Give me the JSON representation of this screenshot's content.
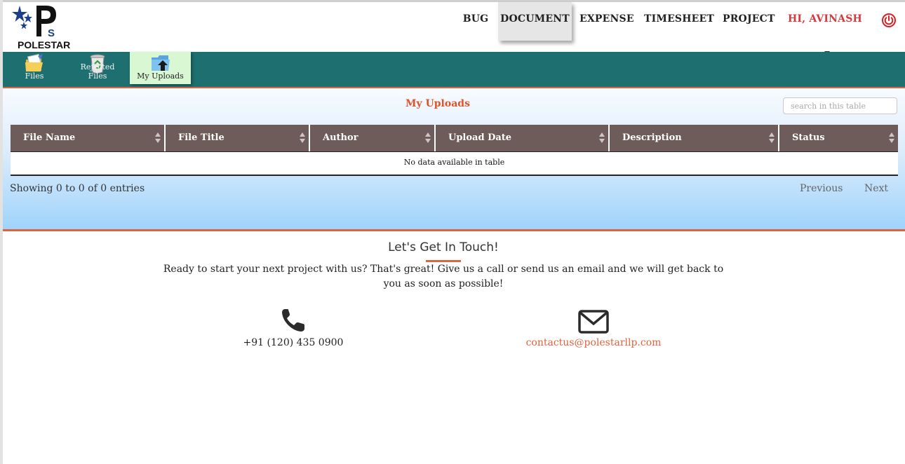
{
  "brand": {
    "logo_text": "POLESTAR",
    "primary_color": "#1e6f70",
    "accent_color": "#e0633d",
    "header_bg": "#6e5c5a"
  },
  "nav": {
    "items": [
      "BUG",
      "DOCUMENT",
      "EXPENSE",
      "TIMESHEET",
      "PROJECT"
    ],
    "active": "DOCUMENT",
    "user": "HI, AVINASH",
    "power_icon": "power-icon"
  },
  "toolbar": {
    "items": [
      {
        "label": "Files",
        "icon": "files-folder-icon"
      },
      {
        "label": "Rejected Files",
        "icon": "recycle-bin-icon"
      },
      {
        "label": "My Uploads",
        "icon": "upload-folder-icon"
      }
    ],
    "active": "My Uploads"
  },
  "main": {
    "title": "My Uploads",
    "search_placeholder": "search in this table",
    "columns": [
      "File Name",
      "File Title",
      "Author",
      "Upload Date",
      "Description",
      "Status"
    ],
    "empty_message": "No data available in table",
    "info": "Showing 0 to 0 of 0 entries",
    "previous": "Previous",
    "next": "Next"
  },
  "footer": {
    "title": "Let's Get In Touch!",
    "text": "Ready to start your next project with us? That's great! Give us a call or send us an email and we will get back to you as soon as possible!",
    "phone": "+91 (120) 435 0900",
    "email": "contactus@polestarllp.com",
    "phone_icon": "phone-icon",
    "email_icon": "envelope-icon"
  }
}
